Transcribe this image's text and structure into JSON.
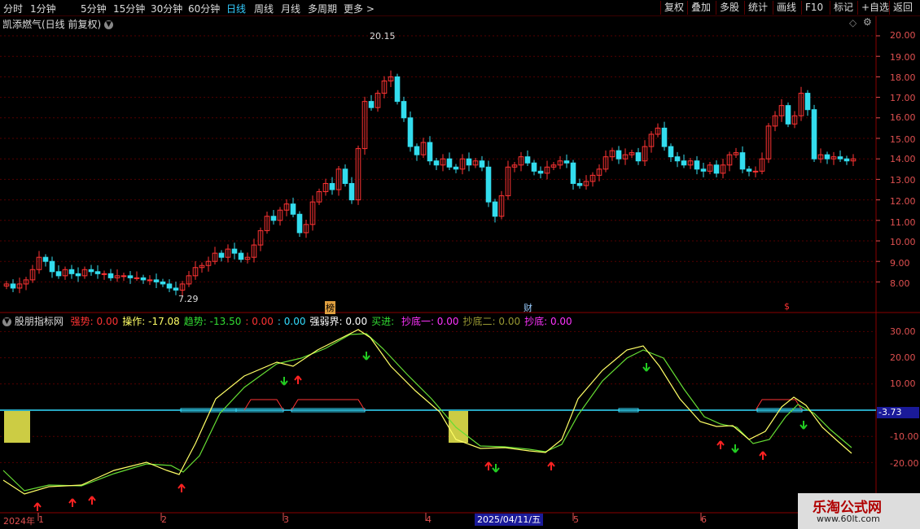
{
  "toolbar": {
    "periods": [
      "分时",
      "1分钟",
      "5分钟",
      "15分钟",
      "30分钟",
      "60分钟",
      "日线",
      "周线",
      "月线",
      "多周期",
      "更多 >"
    ],
    "active_period": "日线",
    "buttons": [
      "复权",
      "叠加",
      "多股",
      "统计",
      "画线",
      "F10",
      "标记",
      "+自选",
      "返回"
    ]
  },
  "main_chart": {
    "title": "凯添燃气(日线 前复权)",
    "y_ticks": [
      "20.00",
      "19.00",
      "18.00",
      "17.00",
      "16.00",
      "15.00",
      "14.00",
      "13.00",
      "12.00",
      "11.00",
      "10.00",
      "9.00",
      "8.00"
    ],
    "high_label": "20.15",
    "low_label": "7.29",
    "markers": [
      "榜",
      "财",
      "$"
    ]
  },
  "indicator": {
    "name": "股朋指标网",
    "items": [
      {
        "label": "强势:",
        "value": "0.00",
        "color": "#ff3333"
      },
      {
        "label": "操作:",
        "value": "-17.08",
        "color": "#ffff66"
      },
      {
        "label": "趋势:",
        "value": "-13.50",
        "color": "#33dd33"
      },
      {
        "label": ":",
        "value": "0.00",
        "color": "#ff3333"
      },
      {
        "label": ":",
        "value": "0.00",
        "color": "#33ddff"
      },
      {
        "label": "强弱界:",
        "value": "0.00",
        "color": "#ffffff"
      },
      {
        "label": "买进:",
        "value": "",
        "color": "#33dd33"
      },
      {
        "label": "抄底一:",
        "value": "0.00",
        "color": "#ff33ff"
      },
      {
        "label": "抄底二:",
        "value": "0.00",
        "color": "#999933"
      },
      {
        "label": "抄底:",
        "value": "0.00",
        "color": "#ff33ff"
      }
    ],
    "y_ticks": [
      "30.00",
      "20.00",
      "10.00",
      "-10.00",
      "-20.00"
    ],
    "current_value": "-3.73"
  },
  "x_axis": {
    "ticks": [
      "2024年",
      "1",
      "2",
      "3",
      "4",
      "5",
      "6"
    ],
    "cursor_date": "2025/04/11/五"
  },
  "watermark": {
    "name": "乐淘公式网",
    "url": "www.60lt.com"
  },
  "colors": {
    "up": "#ff3333",
    "down": "#33ddee",
    "grid": "#550000",
    "axis": "#e05050",
    "zero_line": "#33ddff"
  }
}
